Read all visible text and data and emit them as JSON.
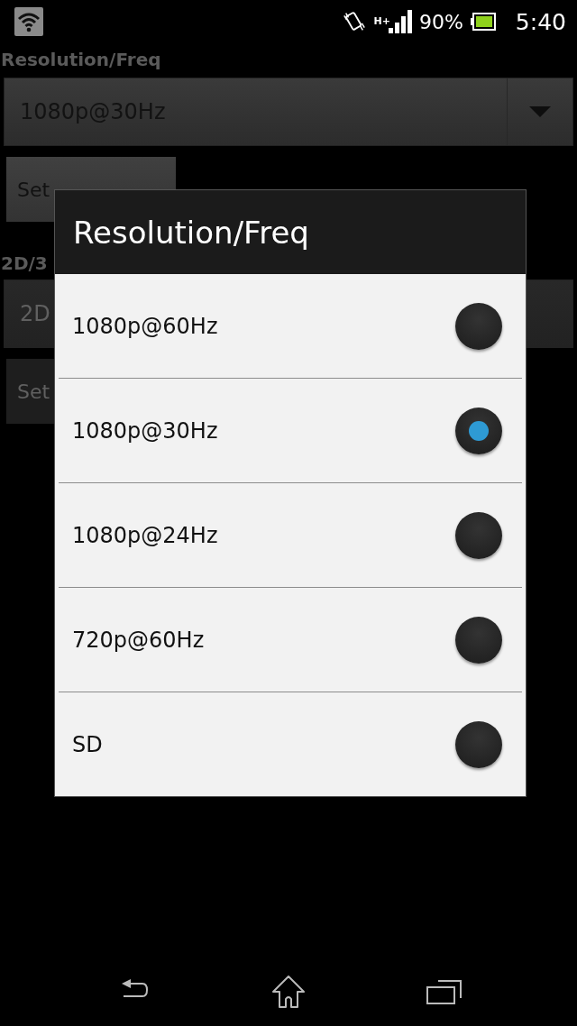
{
  "status_bar": {
    "network": "H+",
    "battery": "90%",
    "time": "5:40"
  },
  "background": {
    "resolution_label": "Resolution/Freq",
    "resolution_spinner": {
      "value": "1080p@30Hz"
    },
    "set_resolution_button": "Set",
    "mode_label": "2D/3",
    "mode_spinner": {
      "value": "2D"
    },
    "set_mode_button": "Set"
  },
  "dialog": {
    "title": "Resolution/Freq",
    "options": [
      {
        "label": "1080p@60Hz",
        "selected": false
      },
      {
        "label": "1080p@30Hz",
        "selected": true
      },
      {
        "label": "1080p@24Hz",
        "selected": false
      },
      {
        "label": "720p@60Hz",
        "selected": false
      },
      {
        "label": "SD",
        "selected": false
      }
    ]
  }
}
